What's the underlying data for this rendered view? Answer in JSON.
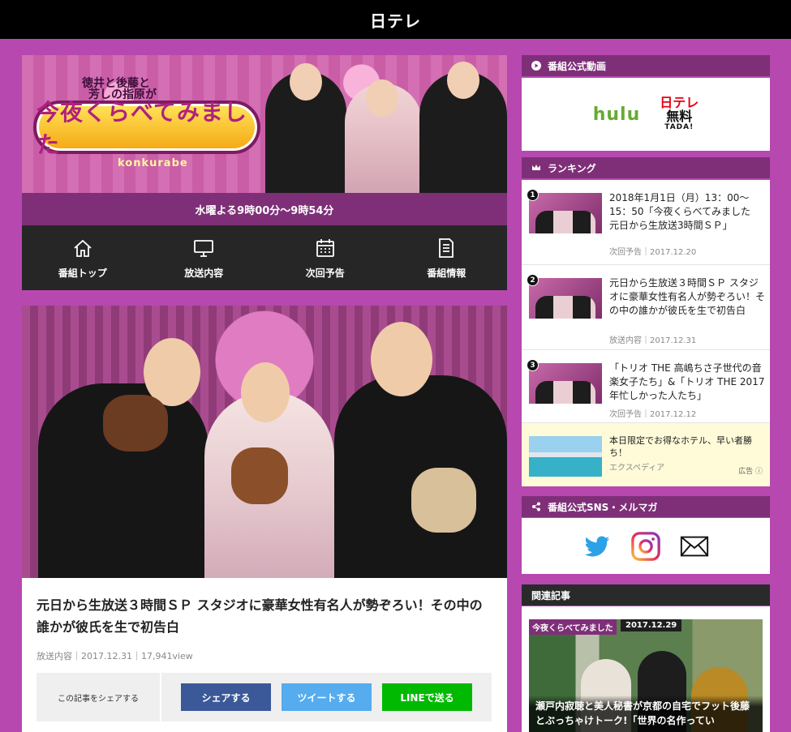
{
  "site": {
    "logo": "日テレ"
  },
  "hero": {
    "subtitle_line1": "徳井と後藤と",
    "subtitle_line2": "芳しの指原が",
    "title": "今夜くらべてみました",
    "romaji": "konkurabe"
  },
  "schedule": "水曜よる9時00分～9時54分",
  "program_nav": [
    {
      "label": "番組トップ",
      "icon": "home-icon"
    },
    {
      "label": "放送内容",
      "icon": "monitor-icon"
    },
    {
      "label": "次回予告",
      "icon": "calendar-icon"
    },
    {
      "label": "番組情報",
      "icon": "document-icon"
    }
  ],
  "article": {
    "headline": "元日から生放送３時間ＳＰ スタジオに豪華女性有名人が勢ぞろい！その中の誰かが彼氏を生で初告白",
    "meta": "放送内容｜2017.12.31｜17,941view",
    "share_label": "この記事をシェアする",
    "share_facebook": "シェアする",
    "share_twitter": "ツイートする",
    "share_line": "LINEで送る"
  },
  "sidebar": {
    "video_heading": "番組公式動画",
    "video_services": {
      "hulu": "hulu",
      "tada_line1": "日テレ",
      "tada_line2": "無料",
      "tada_line3": "TADA!"
    },
    "ranking_heading": "ランキング",
    "ranking": [
      {
        "rank": "1",
        "title": "2018年1月1日（月）13：00～15：50「今夜くらべてみました　元日から生放送3時間ＳＰ」",
        "meta": "次回予告｜2017.12.20"
      },
      {
        "rank": "2",
        "title": "元日から生放送３時間ＳＰ スタジオに豪華女性有名人が勢ぞろい！その中の誰かが彼氏を生で初告白",
        "meta": "放送内容｜2017.12.31"
      },
      {
        "rank": "3",
        "title": "「トリオ THE 高嶋ちさ子世代の音楽女子たち」&「トリオ THE 2017年忙しかった人たち」",
        "meta": "次回予告｜2017.12.12"
      }
    ],
    "ad": {
      "title": "本日限定でお得なホテル、早い者勝ち！",
      "sponsor": "エクスペディア",
      "label": "広告 ⓘ"
    },
    "sns_heading": "番組公式SNS・メルマガ",
    "sns_icons": [
      "twitter-icon",
      "instagram-icon",
      "mail-icon"
    ],
    "related_heading": "関連記事",
    "related": {
      "tag": "今夜くらべてみました",
      "date": "2017.12.29",
      "caption": "瀬戸内寂聴と美人秘書が京都の自宅でフット後藤とぶっちゃけトーク!「世界の名作ってい"
    }
  },
  "colors": {
    "background": "#b648b0",
    "header": "#7e2f78",
    "facebook": "#3b5998",
    "twitter": "#55acee",
    "line": "#00b900"
  }
}
